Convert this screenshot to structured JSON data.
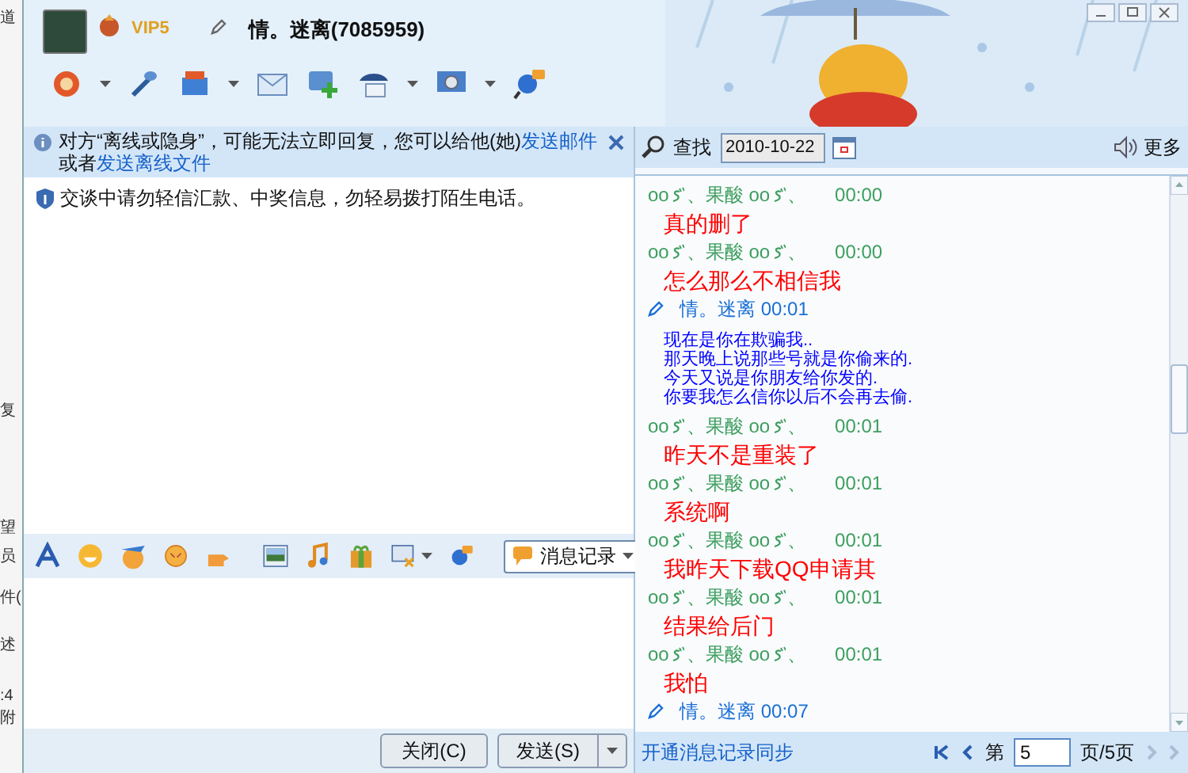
{
  "background_window": {
    "fragments": [
      "道",
      "复",
      "望",
      "员",
      "件(",
      "述",
      ":4",
      "附"
    ]
  },
  "header": {
    "vip_badge": "VIP5",
    "title": "情。迷离(7085959)"
  },
  "offline_notice": {
    "text": "对方“离线或隐身”，可能无法立即回复，您可以给他(她)",
    "link_1": "发送邮件",
    "middle": "或者",
    "link_2": "发送离线文件"
  },
  "safety_notice": {
    "text": "交谈中请勿轻信汇款、中奖信息，勿轻易拨打陌生电话。"
  },
  "input_toolbar": {
    "history_button": "消息记录"
  },
  "buttons": {
    "close": "关闭(C)",
    "send": "发送(S)"
  },
  "history": {
    "search_label": "查找",
    "date": "2010-10-22",
    "more_label": "更多",
    "messages": [
      {
        "kind": "received",
        "sender": [
          {
            "kind": "text",
            "text": "oo"
          },
          {
            "kind": "sign"
          },
          {
            "kind": "text",
            "text": "、果酸 oo"
          },
          {
            "kind": "sign"
          },
          {
            "kind": "text",
            "text": "、"
          }
        ],
        "time": "00:00",
        "lines": [
          "真的删了"
        ]
      },
      {
        "kind": "received",
        "sender": [
          {
            "kind": "text",
            "text": "oo"
          },
          {
            "kind": "sign"
          },
          {
            "kind": "text",
            "text": "、果酸 oo"
          },
          {
            "kind": "sign"
          },
          {
            "kind": "text",
            "text": "、"
          }
        ],
        "time": "00:00",
        "lines": [
          "怎么那么不相信我"
        ]
      },
      {
        "kind": "sent",
        "sender": "情。迷离",
        "time": "00:01",
        "lines": [
          "现在是你在欺骗我..",
          "那天晚上说那些号就是你偷来的.",
          "今天又说是你朋友给你发的.",
          "你要我怎么信你以后不会再去偷."
        ]
      },
      {
        "kind": "received",
        "sender": [
          {
            "kind": "text",
            "text": "oo"
          },
          {
            "kind": "sign"
          },
          {
            "kind": "text",
            "text": "、果酸 oo"
          },
          {
            "kind": "sign"
          },
          {
            "kind": "text",
            "text": "、"
          }
        ],
        "time": "00:01",
        "lines": [
          "昨天不是重装了"
        ]
      },
      {
        "kind": "received",
        "sender": [
          {
            "kind": "text",
            "text": "oo"
          },
          {
            "kind": "sign"
          },
          {
            "kind": "text",
            "text": "、果酸 oo"
          },
          {
            "kind": "sign"
          },
          {
            "kind": "text",
            "text": "、"
          }
        ],
        "time": "00:01",
        "lines": [
          "系统啊"
        ]
      },
      {
        "kind": "received",
        "sender": [
          {
            "kind": "text",
            "text": "oo"
          },
          {
            "kind": "sign"
          },
          {
            "kind": "text",
            "text": "、果酸 oo"
          },
          {
            "kind": "sign"
          },
          {
            "kind": "text",
            "text": "、"
          }
        ],
        "time": "00:01",
        "lines": [
          "我昨天下载QQ申请其"
        ]
      },
      {
        "kind": "received",
        "sender": [
          {
            "kind": "text",
            "text": "oo"
          },
          {
            "kind": "sign"
          },
          {
            "kind": "text",
            "text": "、果酸 oo"
          },
          {
            "kind": "sign"
          },
          {
            "kind": "text",
            "text": "、"
          }
        ],
        "time": "00:01",
        "lines": [
          "结果给后门"
        ]
      },
      {
        "kind": "received",
        "sender": [
          {
            "kind": "text",
            "text": "oo"
          },
          {
            "kind": "sign"
          },
          {
            "kind": "text",
            "text": "、果酸 oo"
          },
          {
            "kind": "sign"
          },
          {
            "kind": "text",
            "text": "、"
          }
        ],
        "time": "00:01",
        "lines": [
          "我怕"
        ]
      },
      {
        "kind": "sent",
        "sender": "情。迷离",
        "time": "00:07"
      }
    ],
    "pager": {
      "sync_link": "开通消息记录同步",
      "prefix": "第",
      "page": "5",
      "suffix": "页/5页"
    }
  }
}
